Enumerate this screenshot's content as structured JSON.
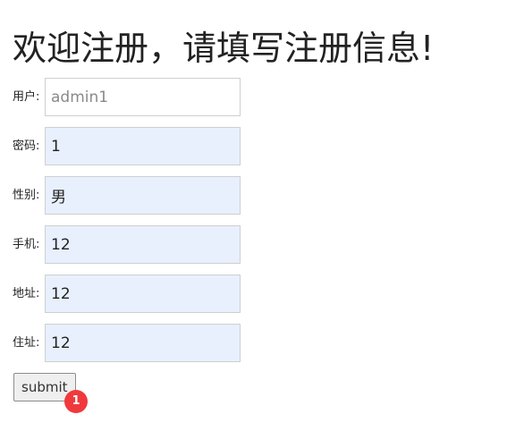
{
  "title": "欢迎注册，请填写注册信息!",
  "form": {
    "fields": [
      {
        "label": "用户:",
        "value": "",
        "placeholder": "admin1"
      },
      {
        "label": "密码:",
        "value": "1"
      },
      {
        "label": "性别:",
        "value": "男"
      },
      {
        "label": "手机:",
        "value": "12"
      },
      {
        "label": "地址:",
        "value": "12"
      },
      {
        "label": "住址:",
        "value": "12"
      }
    ],
    "submit_label": "submit",
    "badge": "1"
  },
  "colors": {
    "autofill_background": "#e8f0fe",
    "badge": "#f0393c"
  }
}
